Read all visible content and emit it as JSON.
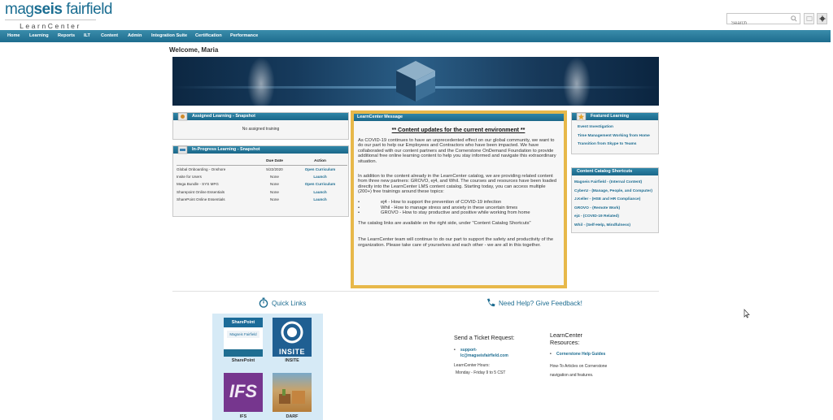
{
  "logo": {
    "main_left": "mag",
    "main_mid": "seis",
    "main_right": " fairfield",
    "sub": "LearnCenter"
  },
  "search": {
    "placeholder": "Search"
  },
  "nav": [
    {
      "label": "Home"
    },
    {
      "label": "Learning"
    },
    {
      "label": "Reports"
    },
    {
      "label": "ILT"
    },
    {
      "label": "Content"
    },
    {
      "label": "Admin"
    },
    {
      "label": "Integration Suite"
    },
    {
      "label": "Certification"
    },
    {
      "label": "Performance"
    }
  ],
  "welcome": "Welcome, Maria",
  "assigned": {
    "title": "Assigned Learning - Snapshot",
    "empty": "No assigned training"
  },
  "inprogress": {
    "title": "In-Progress Learning - Snapshot",
    "columns": [
      "",
      "Due Date",
      "Action"
    ],
    "rows": [
      {
        "name": "Global Onboarding - Onshore",
        "due": "5/22/2020",
        "action": "Open Curriculum"
      },
      {
        "name": "Insite for Users",
        "due": "None",
        "action": "Launch"
      },
      {
        "name": "Mega Bundle - SYS MFG",
        "due": "None",
        "action": "Open Curriculum"
      },
      {
        "name": "Sharepoint Online Essentials",
        "due": "None",
        "action": "Launch"
      },
      {
        "name": "SharePoint Online Essentials",
        "due": "None",
        "action": "Launch"
      }
    ]
  },
  "message": {
    "title": "LearnCenter Message",
    "heading": "** Content updates for the current environment **",
    "p1": "As COVID-19 continues to have an unprecedented effect on our global community, we want to do our part to help our Employees and Contractors who have been impacted. We have collaborated with our content partners and the Cornerstone OnDemand Foundation to provide additional free online learning content to help you stay informed and navigate this extraordinary situation.",
    "p2": "In addition to the content already in the LearnCenter catalog, we are providing related content from three new partners:  GROVO, ej4, and Whil.   The courses and resources have been loaded directly into the LearnCenter LMS content catalog. Starting today, you can access multiple (200+) free trainings around these topics:",
    "bullets": [
      "ej4 - How to support the prevention of COVID-19 infection",
      "Whil - How to manage stress and anxiety in these uncertain times",
      "GROVO - How to stay productive and positive while working from home"
    ],
    "p3": "The catalog links are available on the right side, under \"Content Catalog Shortcuts\"",
    "p4": "The LearnCenter team will continue to do our part to support the safety and productivity of the organization. Please take care of yourselves and each other - we are all in this together."
  },
  "featured": {
    "title": "Featured Learning",
    "items": [
      "Event Investigation",
      "Time Management Working from Home",
      "Transition from Skype to Teams"
    ]
  },
  "catalog": {
    "title": "Content Catalog Shortcuts",
    "items": [
      "Magseis Fairfield - (Internal Content)",
      "CyberU - (Manage, People, and Computer)",
      "J.Keller - (HSE and HR Compliance)",
      "GROVO - (Remote Work)",
      "ej4 - (COVID-19 Related)",
      "Whil - (Self-Help, Mindfulness)"
    ]
  },
  "quicklinks": {
    "title": "Quick Links",
    "tiles": [
      {
        "label": "SharePoint",
        "badge": "SharePoint",
        "badge_sub": "Magseis Fairfield"
      },
      {
        "label": "INSITE",
        "badge": "INSITE"
      },
      {
        "label": "IFS",
        "badge": "IFS"
      },
      {
        "label": "DARF"
      }
    ]
  },
  "help": {
    "title": "Need Help? Give Feedback!",
    "ticket_title": "Send a Ticket Request:",
    "ticket_email": "support-lc@magseisfairfield.com",
    "hours_label": "LearnCenter Hours:",
    "hours": "Monday - Friday 9 to 5 CST",
    "resources_title": "LearnCenter Resources:",
    "resources_link": "Cornerstone Help Guides",
    "resources_note": "How-To Articles on Cornerstone navigation and features."
  },
  "colors": {
    "brand": "#1e6d91",
    "nav": "#2a7fa2",
    "highlight": "#e7b84a"
  }
}
